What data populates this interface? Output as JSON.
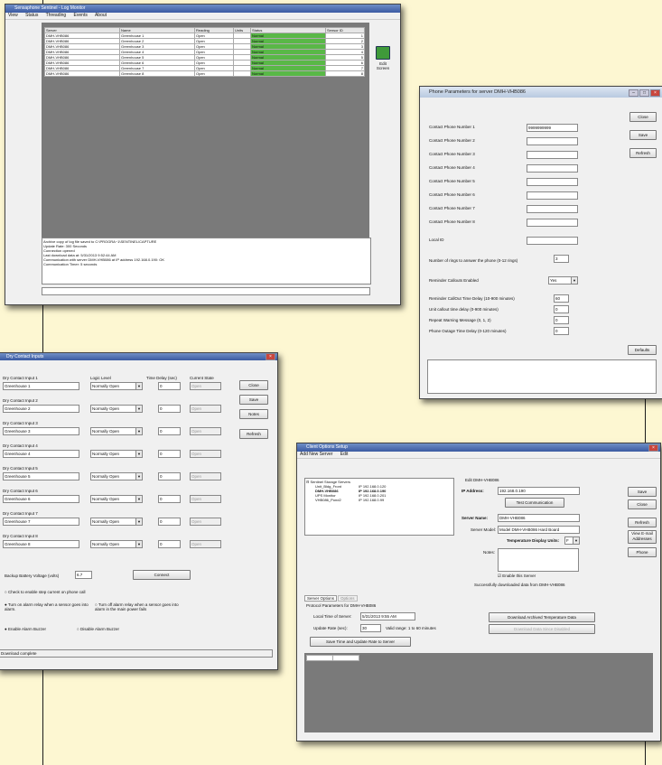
{
  "monitor": {
    "title": "Sensaphone Sentinel - Log Monitor",
    "menu": [
      "View",
      "Status",
      "Threading",
      "Events",
      "About"
    ],
    "columns": [
      "Server",
      "Name",
      "Reading",
      "Units",
      "Status",
      "Sensor ID"
    ],
    "rows": [
      {
        "server": "DMH-VHB086",
        "name": "Greenhouse 1",
        "reading": "Open",
        "units": "",
        "status": "Normal",
        "id": "1"
      },
      {
        "server": "DMH-VHB086",
        "name": "Greenhouse 2",
        "reading": "Open",
        "units": "",
        "status": "Normal",
        "id": "2"
      },
      {
        "server": "DMH-VHB086",
        "name": "Greenhouse 3",
        "reading": "Open",
        "units": "",
        "status": "Normal",
        "id": "3"
      },
      {
        "server": "DMH-VHB086",
        "name": "Greenhouse 4",
        "reading": "Open",
        "units": "",
        "status": "Normal",
        "id": "4"
      },
      {
        "server": "DMH-VHB086",
        "name": "Greenhouse 5",
        "reading": "Open",
        "units": "",
        "status": "Normal",
        "id": "5"
      },
      {
        "server": "DMH-VHB086",
        "name": "Greenhouse 6",
        "reading": "Open",
        "units": "",
        "status": "Normal",
        "id": "6"
      },
      {
        "server": "DMH-VHB086",
        "name": "Greenhouse 7",
        "reading": "Open",
        "units": "",
        "status": "Normal",
        "id": "7"
      },
      {
        "server": "DMH-VHB086",
        "name": "Greenhouse 8",
        "reading": "Open",
        "units": "",
        "status": "Normal",
        "id": "8"
      }
    ],
    "edit_button": "Edit Screen",
    "log_lines": [
      "Archive copy of log file saved to C:\\PROGRA~1\\SENTINEL\\CAPTURE",
      "Update Rate: 300 Seconds",
      "Connection opened",
      "Last download data at: 5/31/2013 9:52:44 AM",
      "Communication with server DMH-VHB086 at IP address 192.168.0.190: OK",
      "Communication Timer: 5 seconds"
    ],
    "status_text": ""
  },
  "phone": {
    "title": "Phone Parameters for server DMH-VHB086",
    "contacts": [
      {
        "label": "Contact Phone Number 1",
        "value": "9999999999"
      },
      {
        "label": "Contact Phone Number 2",
        "value": ""
      },
      {
        "label": "Contact Phone Number 3",
        "value": ""
      },
      {
        "label": "Contact Phone Number 4",
        "value": ""
      },
      {
        "label": "Contact Phone Number 5",
        "value": ""
      },
      {
        "label": "Contact Phone Number 6",
        "value": ""
      },
      {
        "label": "Contact Phone Number 7",
        "value": ""
      },
      {
        "label": "Contact Phone Number 8",
        "value": ""
      }
    ],
    "local_id_label": "Local ID",
    "local_id_value": "",
    "rings_label": "Number of rings to answer the phone (0-12 rings)",
    "rings_value": "3",
    "callouts_label": "Reminder Callouts Enabled",
    "callouts_value": "Yes",
    "params": [
      {
        "label": "Reminder CallOut Time Delay (10-900 minutes)",
        "value": "60"
      },
      {
        "label": "Unit callout time delay (0-900 minutes)",
        "value": "0"
      },
      {
        "label": "Repeat Warning Message (0, 1, 2)",
        "value": "0"
      },
      {
        "label": "Phone Outage Time Delay (0-120 minutes)",
        "value": "0"
      }
    ],
    "buttons": {
      "close": "Close",
      "save": "Save",
      "refresh": "Refresh",
      "defaults": "Defaults"
    }
  },
  "dry": {
    "title": "Dry Contact Inputs",
    "headers": {
      "input": "Dry Contact Input 1",
      "logic": "Logic Level",
      "delay": "Time Delay (sec)",
      "state": "Current State"
    },
    "inputs": [
      {
        "label": "Dry Contact Input 1",
        "name": "Greenhouse 1",
        "logic": "Normally Open",
        "delay": "0",
        "state": "Open"
      },
      {
        "label": "Dry Contact Input 2",
        "name": "Greenhouse 2",
        "logic": "Normally Open",
        "delay": "0",
        "state": "Open"
      },
      {
        "label": "Dry Contact Input 3",
        "name": "Greenhouse 3",
        "logic": "Normally Open",
        "delay": "0",
        "state": "Open"
      },
      {
        "label": "Dry Contact Input 4",
        "name": "Greenhouse 4",
        "logic": "Normally Open",
        "delay": "0",
        "state": "Open"
      },
      {
        "label": "Dry Contact Input 5",
        "name": "Greenhouse 5",
        "logic": "Normally Open",
        "delay": "0",
        "state": "Open"
      },
      {
        "label": "Dry Contact Input 6",
        "name": "Greenhouse 6",
        "logic": "Normally Open",
        "delay": "0",
        "state": "Open"
      },
      {
        "label": "Dry Contact Input 7",
        "name": "Greenhouse 7",
        "logic": "Normally Open",
        "delay": "0",
        "state": "Open"
      },
      {
        "label": "Dry Contact Input 8",
        "name": "Greenhouse 8",
        "logic": "Normally Open",
        "delay": "0",
        "state": "Open"
      }
    ],
    "buttons": {
      "close": "Close",
      "save": "Save",
      "notes": "Notes",
      "refresh": "Refresh",
      "connect": "Connect"
    },
    "battery_label": "Backup Battery Voltage (volts)",
    "battery_value": "6.7",
    "opt1": "Check to enable step current on phone call",
    "opt2": "Turn on alarm relay when a sensor goes into alarm.",
    "opt3": "Turn off alarm relay when a sensor goes into alarm in the main power fails",
    "buzzer_on": "Enable Alarm Buzzer",
    "buzzer_off": "Disable Alarm Buzzer",
    "status": "Download complete"
  },
  "setup": {
    "title": "Client Options Setup",
    "menu": [
      "Add New Server",
      "Edit"
    ],
    "tree_root": "Sentinel Storage Servers",
    "tree": [
      {
        "name": "Unit_Bldg_Front",
        "ip": "IP 192.168.0.120"
      },
      {
        "name": "DMH-VHB086",
        "ip": "IP 192.168.0.190"
      },
      {
        "name": "UPS Monitor",
        "ip": "IP 192.168.0.201"
      },
      {
        "name": "VHB086_Pond2",
        "ip": "IP 192.168.0.99"
      }
    ],
    "edit_label": "Edit DMH-VHB086",
    "ip_label": "IP Address:",
    "ip_value": "192.168.0.190",
    "test_btn": "Test Communication",
    "server_name_label": "Server Name:",
    "server_name_value": "DMH-VHB086",
    "model_label": "Server Model:",
    "model_value": "Model DMH-VHB086 Hard Board",
    "temp_label": "Temperature Display Units:",
    "temp_value": "F",
    "notes_label": "Notes:",
    "enable_label": "Enable this Server",
    "download_label": "Successfully downloaded data from DMH-VHB086",
    "buttons": [
      "Save",
      "Close",
      "Refresh",
      "View E-mail Addresses",
      "Phone"
    ],
    "tabs": [
      "Server Options",
      "Options"
    ],
    "protocol_label": "Protocol Parameters for DMH-VHB086",
    "local_time_label": "Local Time of Server:",
    "local_time_value": "5/31/2013 9:55 AM",
    "update_label": "Update Rate (sec):",
    "update_value": "30",
    "update_note": "Valid range: 1 to 60 minutes",
    "save_time_btn": "Save Time and Update Rate to Server",
    "download_btn": "Download Archived Temperature Data",
    "download_btn2": "Download Data Since Disabled"
  }
}
